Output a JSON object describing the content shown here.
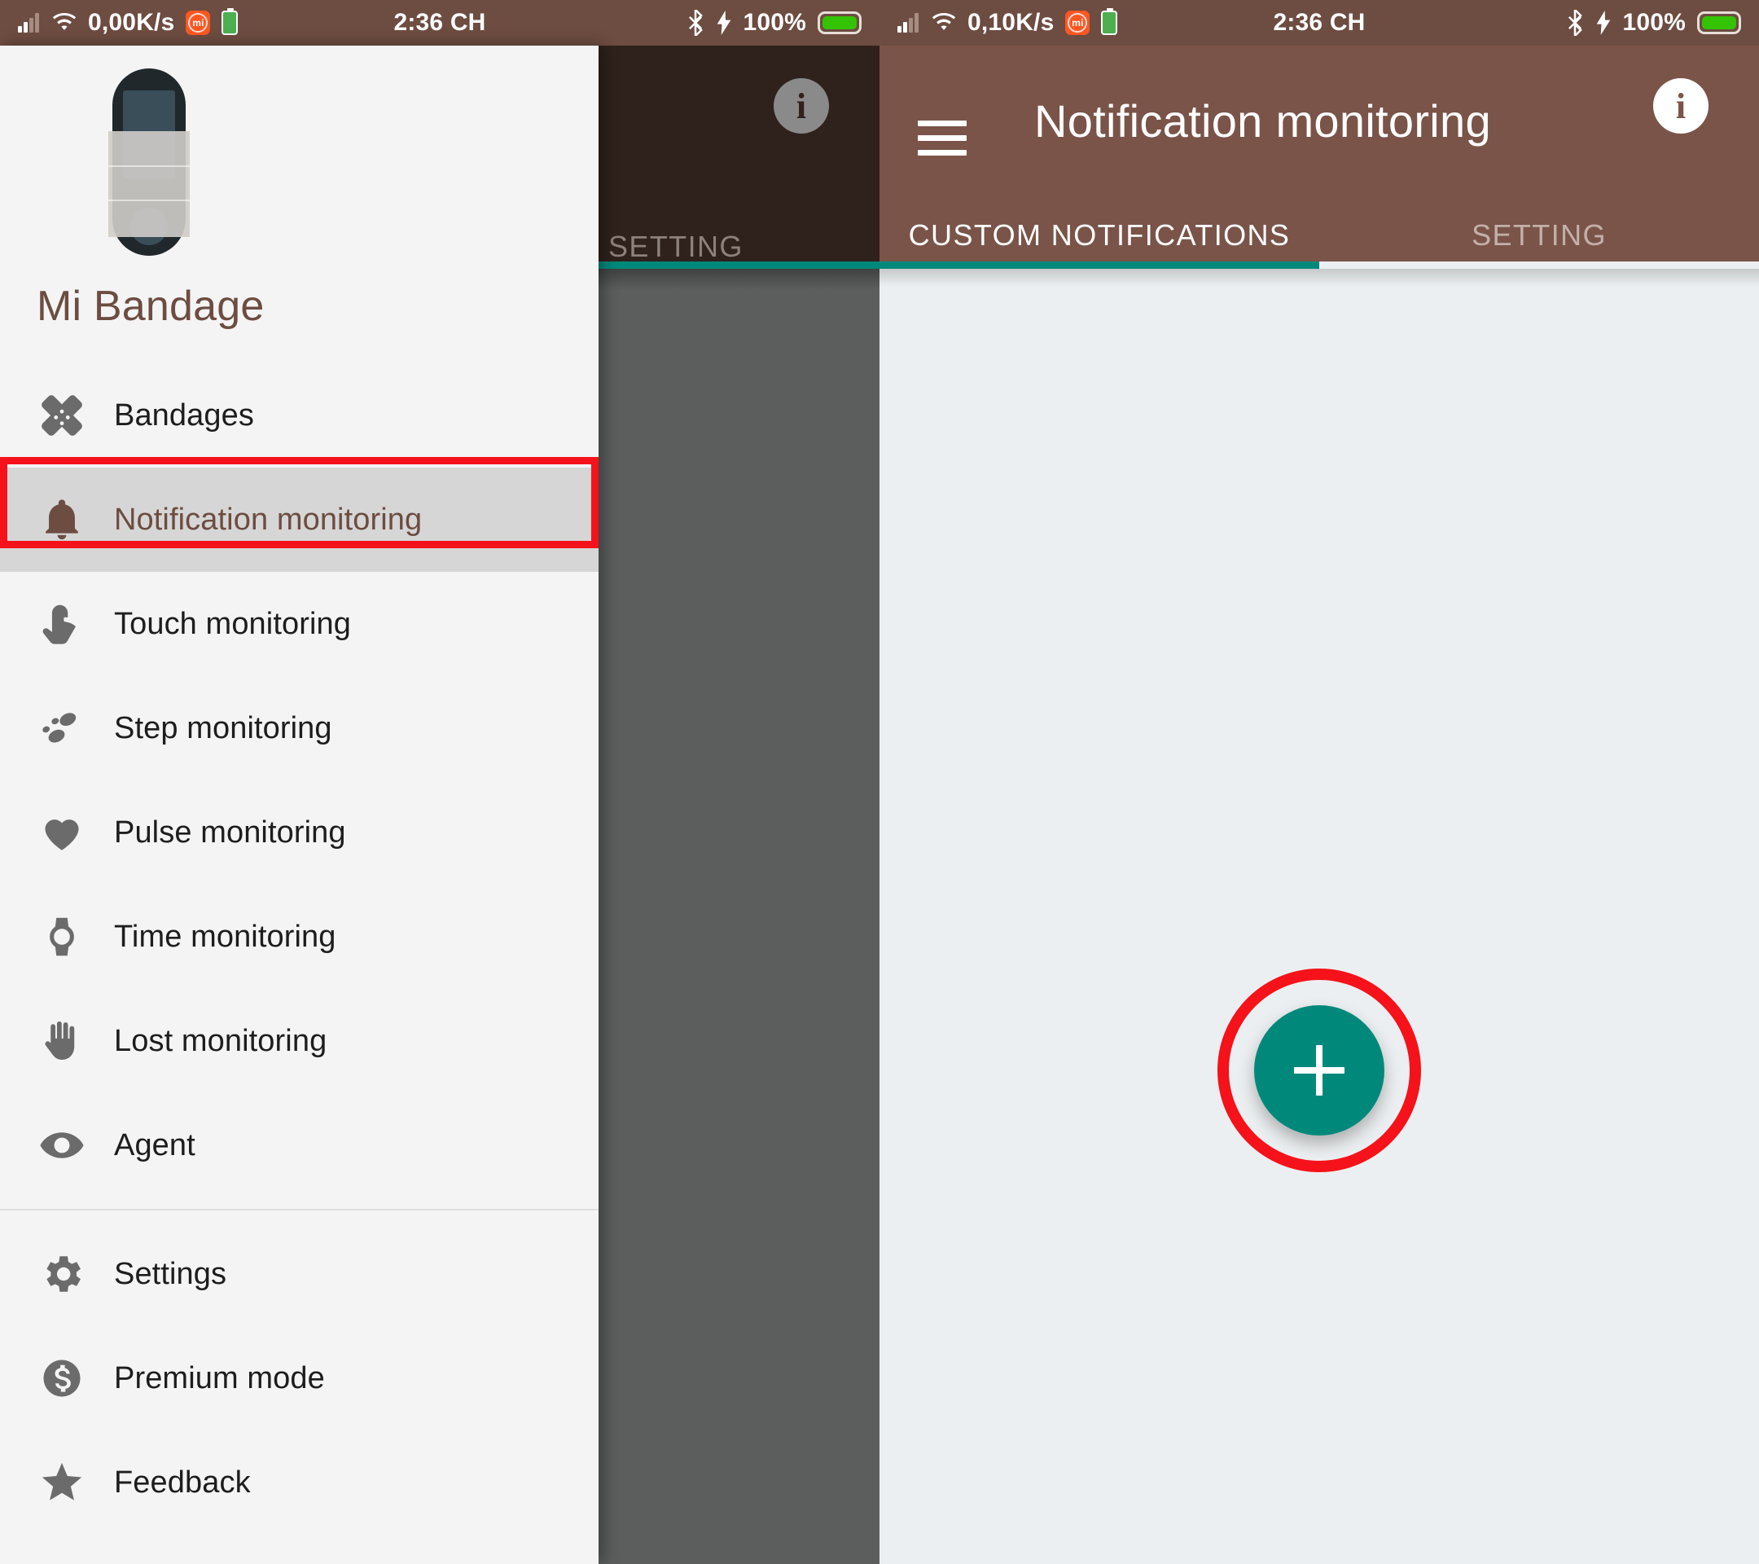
{
  "status_bar": {
    "left": {
      "network_speed": "0,00K/s",
      "time": "2:36 CH",
      "battery_percent": "100%",
      "icons": [
        "signal-icon",
        "wifi-icon",
        "miui-icon",
        "green-battery-icon",
        "bluetooth-icon",
        "charging-bolt-icon",
        "battery-icon"
      ]
    },
    "right": {
      "network_speed": "0,10K/s",
      "time": "2:36 CH",
      "battery_percent": "100%"
    }
  },
  "drawer": {
    "app_title": "Mi Bandage",
    "logo_name": "mi-band-bandage-logo",
    "items": [
      {
        "label": "Bandages",
        "icon": "bandage-cross-icon",
        "selected": false,
        "highlighted": true
      },
      {
        "label": "Notification monitoring",
        "icon": "bell-icon",
        "selected": true,
        "highlighted": false
      },
      {
        "label": "Touch monitoring",
        "icon": "touch-hand-icon",
        "selected": false,
        "highlighted": false
      },
      {
        "label": "Step monitoring",
        "icon": "footsteps-icon",
        "selected": false,
        "highlighted": false
      },
      {
        "label": "Pulse monitoring",
        "icon": "heart-icon",
        "selected": false,
        "highlighted": false
      },
      {
        "label": "Time monitoring",
        "icon": "watch-icon",
        "selected": false,
        "highlighted": false
      },
      {
        "label": "Lost monitoring",
        "icon": "open-hand-icon",
        "selected": false,
        "highlighted": false
      },
      {
        "label": "Agent",
        "icon": "eye-icon",
        "selected": false,
        "highlighted": false
      }
    ],
    "footer_items": [
      {
        "label": "Settings",
        "icon": "gear-icon"
      },
      {
        "label": "Premium mode",
        "icon": "dollar-circle-icon"
      },
      {
        "label": "Feedback",
        "icon": "star-icon"
      }
    ]
  },
  "left_screen": {
    "visible_tab_label": "SETTING",
    "info_icon": "info-icon"
  },
  "right_screen": {
    "menu_icon": "hamburger-menu-icon",
    "title": "Notification monitoring",
    "info_icon": "info-icon",
    "tabs": [
      {
        "label": "CUSTOM NOTIFICATIONS",
        "active": true
      },
      {
        "label": "SETTING",
        "active": false
      }
    ],
    "fab": {
      "icon": "plus-icon",
      "label": "+"
    }
  },
  "colors": {
    "brand_brown": "#7a5449",
    "status_bar_brown": "#6d4c41",
    "accent_teal": "#00897b",
    "highlight_red": "#f5121a",
    "scrim_gray": "#5c5e5e",
    "drawer_bg": "#f4f4f4",
    "content_bg": "#eceff1"
  }
}
